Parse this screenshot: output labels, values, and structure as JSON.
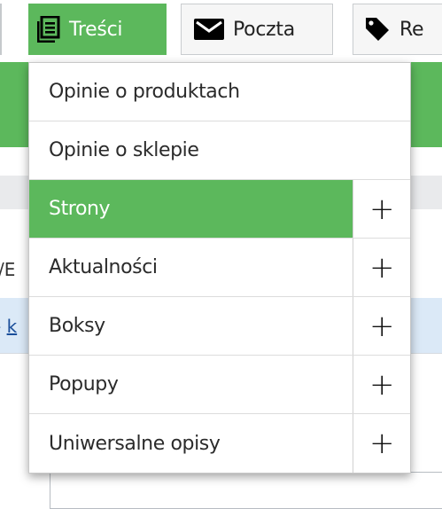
{
  "tabs": [
    {
      "label": "Treści",
      "icon": "list-icon",
      "active": true
    },
    {
      "label": "Poczta",
      "icon": "envelope-icon",
      "active": false
    },
    {
      "label": "Re",
      "icon": "tag-icon",
      "active": false
    }
  ],
  "background": {
    "column_label": "/E",
    "link_prefix": "- ",
    "link_text": "k"
  },
  "dropdown": {
    "items": [
      {
        "label": "Opinie o produktach",
        "has_add": false
      },
      {
        "label": "Opinie o sklepie",
        "has_add": false
      },
      {
        "label": "Strony",
        "has_add": true,
        "active": true
      },
      {
        "label": "Aktualności",
        "has_add": true
      },
      {
        "label": "Boksy",
        "has_add": true
      },
      {
        "label": "Popupy",
        "has_add": true
      },
      {
        "label": "Uniwersalne opisy",
        "has_add": true
      }
    ],
    "add_symbol": "+"
  },
  "colors": {
    "accent_green": "#5cb85c",
    "row_highlight": "#dbe9f7",
    "header_gray": "#e9eaec"
  }
}
